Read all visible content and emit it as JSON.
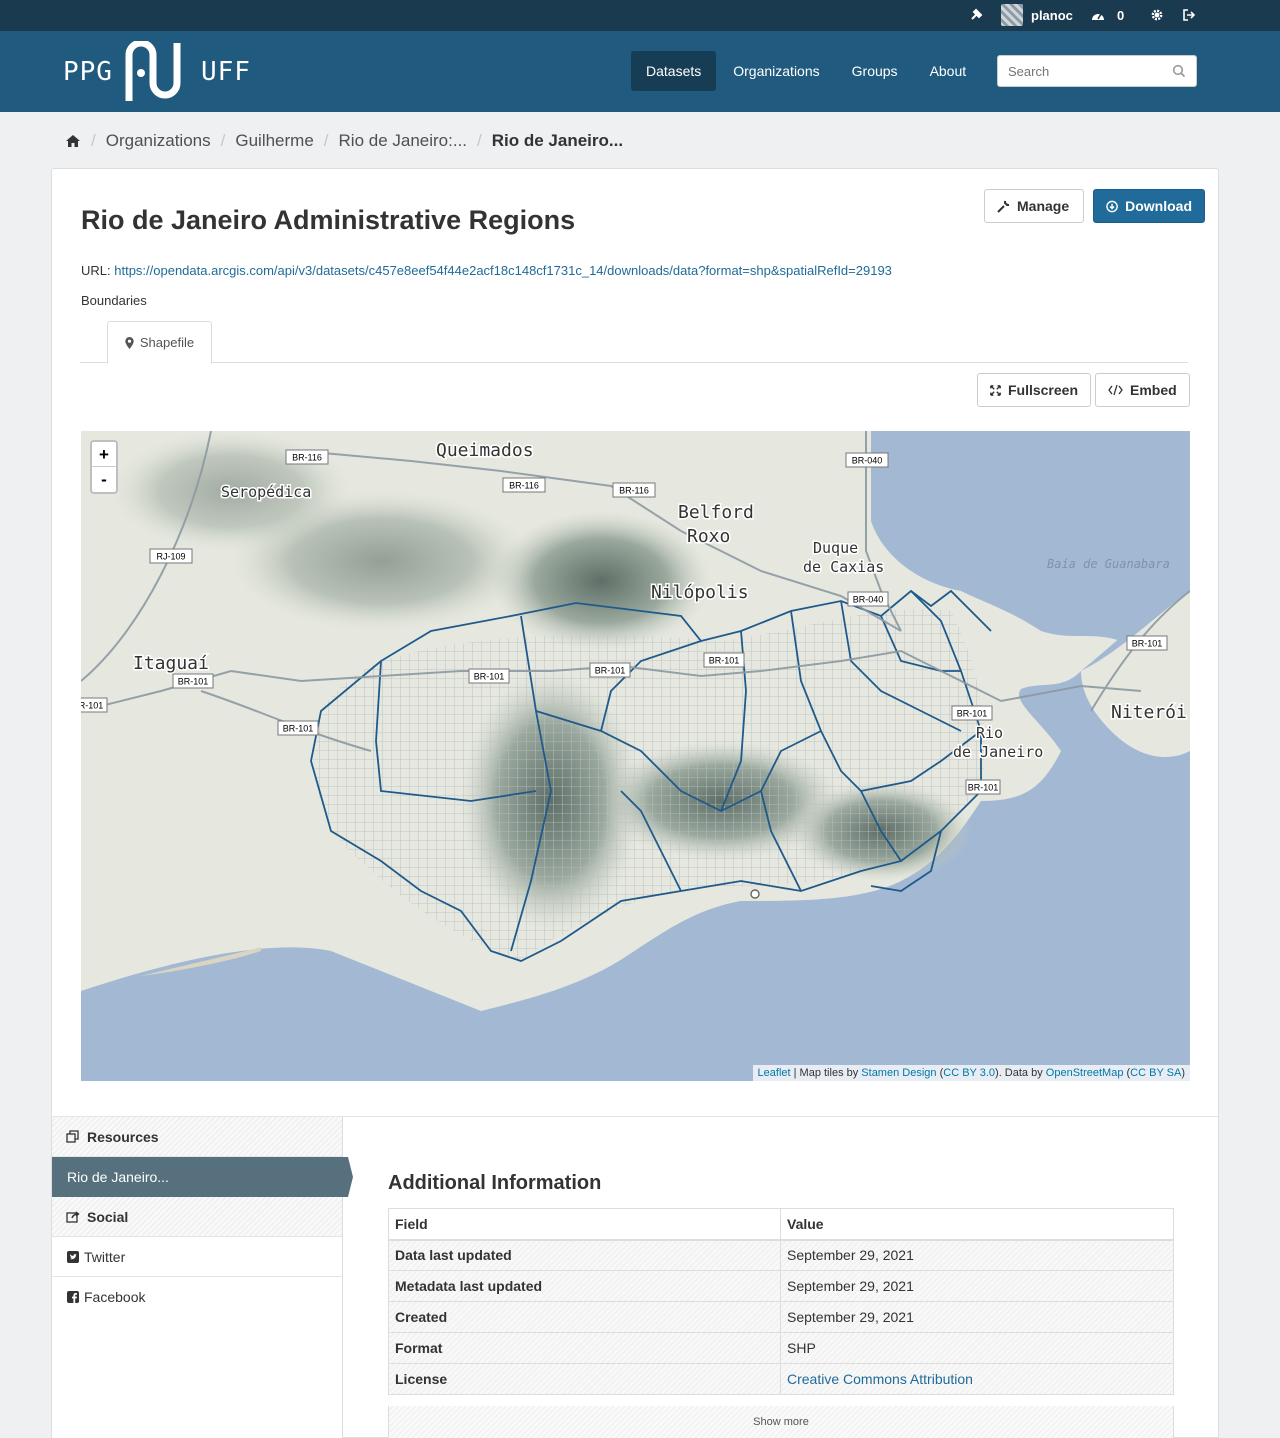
{
  "account": {
    "username": "planoc",
    "dashboard_count": "0",
    "icons": [
      "sysadmin-hammer-icon",
      "dashboard-icon",
      "settings-gear-icon",
      "logout-icon"
    ]
  },
  "site": {
    "logo_left": "PPG",
    "logo_right": "UFF"
  },
  "nav": {
    "items": [
      "Datasets",
      "Organizations",
      "Groups",
      "About"
    ],
    "active": "Datasets"
  },
  "search": {
    "placeholder": "Search"
  },
  "breadcrumb": {
    "items": [
      "Organizations",
      "Guilherme",
      "Rio de Janeiro:..."
    ],
    "current": "Rio de Janeiro..."
  },
  "resource": {
    "manage_label": "Manage",
    "download_label": "Download",
    "title": "Rio de Janeiro Administrative Regions",
    "url_label": "URL: ",
    "url": "https://opendata.arcgis.com/api/v3/datasets/c457e8eef54f44e2acf18c148cf1731c_14/downloads/data?format=shp&spatialRefId=29193",
    "description": "Boundaries",
    "tab_label": "Shapefile",
    "fullscreen_label": "Fullscreen",
    "embed_label": "Embed"
  },
  "map": {
    "zoom_in": "+",
    "zoom_out": "-",
    "place_labels": [
      "Queimados",
      "Seropédica",
      "Belford",
      "Roxo",
      "Duque",
      "de Caxias",
      "Nilópolis",
      "Itaguaí",
      "Niterói",
      "Rio",
      "de Janeiro",
      "Baía de Guanabara"
    ],
    "road_shields": [
      "BR-116",
      "BR-116",
      "BR-116",
      "BR-040",
      "RJ-109",
      "BR-040",
      "BR-101",
      "BR-101",
      "BR-101",
      "BR-101",
      "BR-101",
      "BR-101",
      "BR-101",
      "BR-101",
      "BR-101"
    ],
    "attribution": {
      "leaflet": "Leaflet",
      "sep1": " | Map tiles by ",
      "stamen": "Stamen Design",
      "p1": " (",
      "ccby": "CC BY 3.0",
      "p2": "). Data by ",
      "osm": "OpenStreetMap",
      "p3": " (",
      "ccbysa": "CC BY SA",
      "p4": ")"
    },
    "colors": {
      "water": "#a3b9d3",
      "land": "#e8e9e3",
      "boundary": "#1f5a8a"
    }
  },
  "sidebar": {
    "resources_heading": "Resources",
    "resource_item": "Rio de Janeiro...",
    "social_heading": "Social",
    "twitter": "Twitter",
    "facebook": "Facebook"
  },
  "additional_info": {
    "title": "Additional Information",
    "headers": [
      "Field",
      "Value"
    ],
    "rows": [
      {
        "field": "Data last updated",
        "value": "September 29, 2021"
      },
      {
        "field": "Metadata last updated",
        "value": "September 29, 2021"
      },
      {
        "field": "Created",
        "value": "September 29, 2021"
      },
      {
        "field": "Format",
        "value": "SHP"
      },
      {
        "field": "License",
        "value": "Creative Commons Attribution"
      }
    ],
    "show_more": "Show more"
  },
  "colors": {
    "topbar": "#1a3a4f",
    "masthead": "#205a7e",
    "primary": "#206b99",
    "sidebar_active": "#56707d"
  }
}
